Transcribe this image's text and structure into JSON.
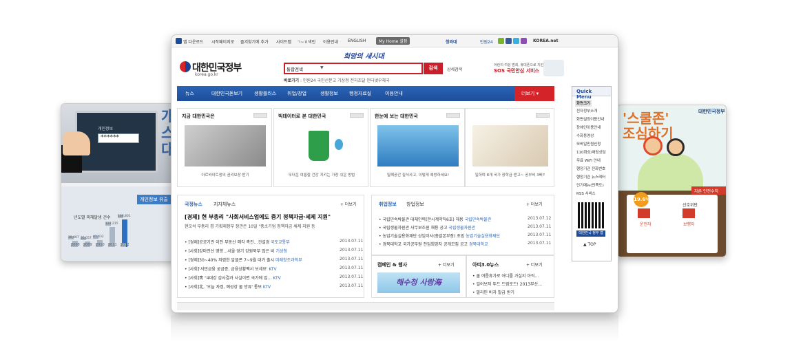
{
  "left_card": {
    "label": "개인정보",
    "password": "******",
    "big_text": "개\n스\n대",
    "chart_title": "개인정보 유출",
    "chart_caption": "년도별 피해발생 건수",
    "bars": [
      {
        "year": "2008",
        "value": 39007
      },
      {
        "year": "2009",
        "value": 35057
      },
      {
        "year": "2010",
        "value": 41432
      },
      {
        "year": "2011",
        "value": 122215
      },
      {
        "year": "2012",
        "value": 166801
      }
    ],
    "bar_labels": [
      "39,007",
      "35,057",
      "41,432",
      "122,215",
      "166,801"
    ]
  },
  "right_card": {
    "logo": "대한민국정부",
    "title": "'스쿨존'\n조심하기",
    "pct": "19.6%",
    "ribbon": "자른 안전수칙",
    "label_center": "신호위반",
    "label_left": "운전자",
    "label_right": "보행자"
  },
  "main": {
    "topbar": {
      "links": [
        "앱 다운로드",
        "시작페이지로",
        "즐겨찾기에 추가",
        "사이트맵",
        "ㄱ~ㅎ색인",
        "이용안내",
        "ENGLISH"
      ],
      "my_home": "My Home 설정",
      "right_links": [
        "청와대",
        "민원24",
        "KOREA.net"
      ]
    },
    "header": {
      "logo_text": "대한민국정부",
      "logo_url": "korea.go.kr",
      "slogan": "희망의 새시대",
      "search_select": "통합검색",
      "search_button": "검색",
      "search_detail": "상세검색",
      "quick_label": "바로가기",
      "quick_links": "민원24  국민신문고  기상청  전자조달  인터넷우체국",
      "sos_line1": "어린이·여성 범죄, 휴대폰으로 지킨다.",
      "sos_line2": "SOS 국민안심 서비스"
    },
    "nav": {
      "items": [
        "뉴스",
        "대한민국돋보기",
        "생활플러스",
        "취업/창업",
        "생활정보",
        "행정자료실",
        "이용안내"
      ],
      "more": "더보기"
    },
    "quick_menu": {
      "title": "Quick Menu",
      "items": [
        "화면크기",
        "전자정부소개",
        "화면설정이용안내",
        "장애인이용안내",
        "수화동영상",
        "모바일민원신청",
        "110화상/채팅상담",
        "무료 WiFi 안내",
        "행정기관 전화번호",
        "행정기관 뉴스레터",
        "인기메뉴(만족도)",
        "RSS 서비스"
      ],
      "qr_caption": "대한민국 정부 앱",
      "top": "▲ TOP"
    },
    "panels": [
      {
        "title": "지금 대한민국은",
        "caption": "아르바이트생의 권리보장 받기"
      },
      {
        "title": "빅데이터로 본 대한민국",
        "caption": "무더운 여름철 건강 지키는 가장 쉬운 방법"
      },
      {
        "title": "한눈에 보는 대한민국",
        "caption": "밀폐공간 질식사고, 이렇게 예방하세요!"
      },
      {
        "title": "",
        "caption": "일하며 8개 국가 장학금 받고~ 공부비 3배↑"
      }
    ],
    "news": {
      "tab_on": "국정뉴스",
      "tab_off": "지자체뉴스",
      "more": "+ 더보기",
      "headline": "[경제] 현 부총리 \"사회서비스업에도 중기 정책자금·세제 지원\"",
      "summary": "현오석 부총리 겸 기획재정부 장관은 10일 \"중소기업 정책자금 세제 지원 등",
      "items": [
        {
          "text": "[경제]공공기관 이전 부동산 매각 촉진…건설경",
          "src": "국토교통부",
          "date": "2013.07.11"
        },
        {
          "text": "[사회]강마전선 영향…서울·경기 강원북부 많은 비",
          "src": "기상청",
          "date": "2013.07.11"
        },
        {
          "text": "[경제]30~40% 저렴한 알뜰폰 7~9월 대거 출시",
          "src": "미래창조과학부",
          "date": "2013.07.11"
        },
        {
          "text": "[사회]'서민금융 궁금증, 금융상황팩서 보세요'",
          "src": "KTV",
          "date": "2013.07.11"
        },
        {
          "text": "[사회]靑 \"4대강 감사결과 사실이면 국가에 업…",
          "src": "KTV",
          "date": "2013.07.11"
        },
        {
          "text": "[사회]北, '오늘 자정, 예성강 물 방류' 통보",
          "src": "KTV",
          "date": "2013.07.11"
        }
      ]
    },
    "jobs": {
      "tab_on": "취업정보",
      "tab_off": "창업정보",
      "more": "+ 더보기",
      "items": [
        {
          "text": "국립민속박물관 대체인력(한시계약직6호) 채용",
          "src": "국립민속박물관",
          "date": "2013.07.12"
        },
        {
          "text": "국립생물자원관 사무보조원 채용 공고",
          "src": "국립생물자원관",
          "date": "2013.07.11"
        },
        {
          "text": "농업기술실용화재단 상임이사(총괄본부장) 초빙",
          "src": "농업기술실용화재단",
          "date": "2013.07.11"
        },
        {
          "text": "경북대학교 국가공무원 전입희망자 공개모집 공고",
          "src": "경북대학교",
          "date": "2013.07.11"
        }
      ]
    },
    "campaign": {
      "title": "캠페인 & 행사",
      "more": "+ 더보기",
      "banner": "해수청 사랑海"
    },
    "agora": {
      "title": "아띠3.0뉴스",
      "more": "+ 더보기",
      "items": [
        "쿨 여름휴가로 어디를 가실지 아직…",
        "걸어보자 뚜드 드림로드! 2013부산…",
        "필리핀 비자 발급 받기"
      ]
    }
  }
}
